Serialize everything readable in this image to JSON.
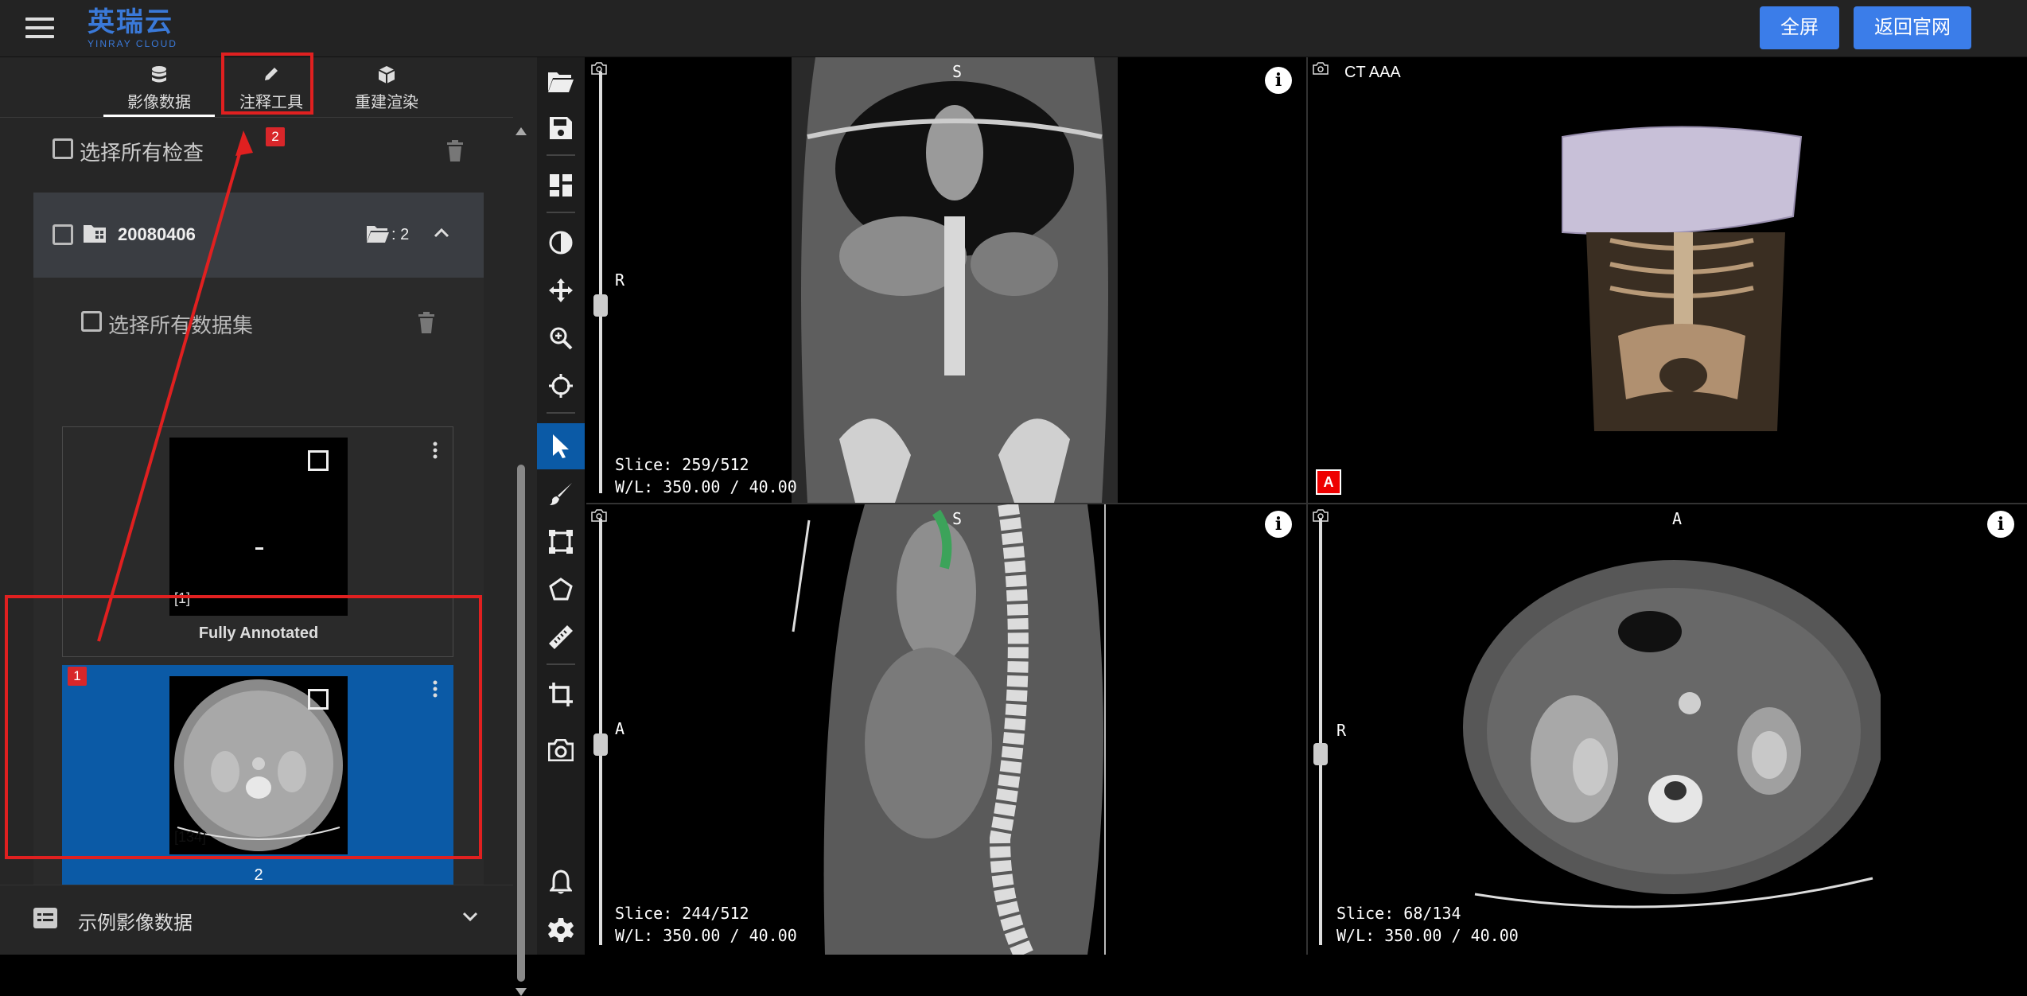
{
  "header": {
    "logo_cn": "英瑞云",
    "logo_en": "YINRAY CLOUD",
    "fullscreen_label": "全屏",
    "official_site_label": "返回官网"
  },
  "left_tabs": [
    {
      "label": "影像数据",
      "icon": "database-icon"
    },
    {
      "label": "注释工具",
      "icon": "pencil-icon"
    },
    {
      "label": "重建渲染",
      "icon": "cube-icon"
    }
  ],
  "select_all_exams": "选择所有检查",
  "study": {
    "date": "20080406",
    "series_count": ": 2"
  },
  "select_all_datasets": "选择所有数据集",
  "datasets": [
    {
      "count": "[1]",
      "name": "Fully Annotated"
    },
    {
      "count": "[134]",
      "name": "2"
    }
  ],
  "badges": {
    "first": "1",
    "second": "2"
  },
  "examples_label": "示例影像数据",
  "viewports": {
    "coronal": {
      "top": "S",
      "left": "R",
      "slice": "Slice: 259/512",
      "wl": "W/L: 350.00 / 40.00"
    },
    "volume": {
      "title": "CT AAA",
      "orient": "A"
    },
    "sagittal": {
      "top": "S",
      "left": "A",
      "slice": "Slice: 244/512",
      "wl": "W/L: 350.00 / 40.00"
    },
    "axial": {
      "top": "A",
      "left": "R",
      "slice": "Slice: 68/134",
      "wl": "W/L: 350.00 / 40.00"
    }
  },
  "colors": {
    "accent": "#3b7de9",
    "selected": "#0b5aa6",
    "highlight": "#e02020",
    "panel": "#262626"
  }
}
